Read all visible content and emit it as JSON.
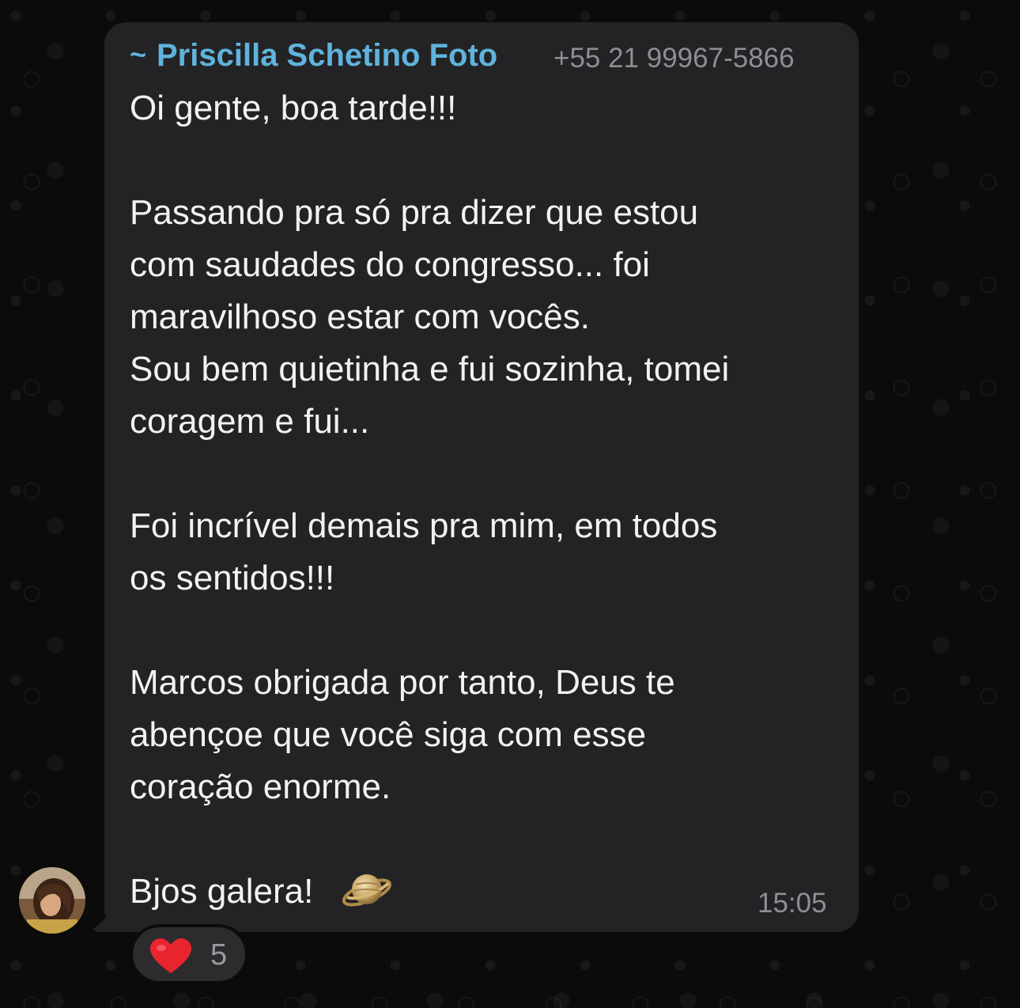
{
  "message": {
    "sender_prefix": "~",
    "sender_name": "Priscilla Schetino Foto",
    "sender_phone": "+55 21 99967-5866",
    "text": "Oi gente, boa tarde!!!\n\nPassando pra só pra dizer que estou\ncom saudades do congresso... foi\nmaravilhoso estar com vocês.\nSou bem quietinha e fui sozinha, tomei\ncoragem e fui...\n\nFoi incrível demais pra mim, em todos\nos sentidos!!!\n\nMarcos obrigada por tanto, Deus te\nabençoe que você siga com esse\ncoração enorme.\n\nBjos galera!",
    "emoji_icon": "ringed-planet-icon",
    "time": "15:05"
  },
  "reaction": {
    "icon": "heart-icon",
    "count": "5"
  },
  "colors": {
    "background": "#0b0b0b",
    "bubble": "#232325",
    "sender_name": "#5fb3dd",
    "meta_text": "#8e8e93",
    "message_text": "#f2f2f2",
    "heart": "#e8242f"
  }
}
